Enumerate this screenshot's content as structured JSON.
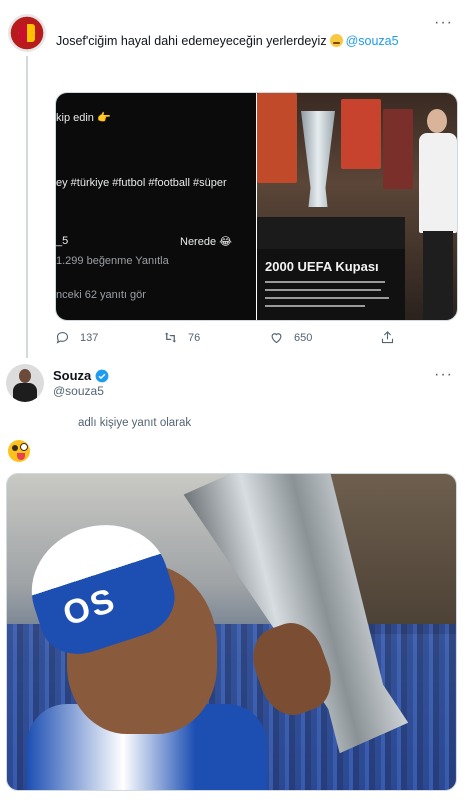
{
  "tweet1": {
    "text_before": "Josef'ciğim hayal dahi edemeyeceğin yerlerdeyiz",
    "mention": "@souza5",
    "more": "···",
    "media_left_lines": [
      "kip edin 👉",
      "ey #türkiye #futbol #football #süper",
      "_5",
      "Nerede 😂",
      "1.299 beğenme      Yanıtla",
      "nceki 62 yanıtı gör"
    ],
    "plaque_title": "2000 UEFA Kupası",
    "actions": {
      "replies": "137",
      "retweets": "76",
      "likes": "650"
    }
  },
  "tweet2": {
    "name": "Souza",
    "handle": "@souza5",
    "more": "···",
    "reply_note": "adlı kişiye yanıt olarak",
    "image_scarf_text": "OS"
  },
  "colors": {
    "accent": "#1d9bf0",
    "muted": "#536471",
    "border": "#cfd9de"
  }
}
